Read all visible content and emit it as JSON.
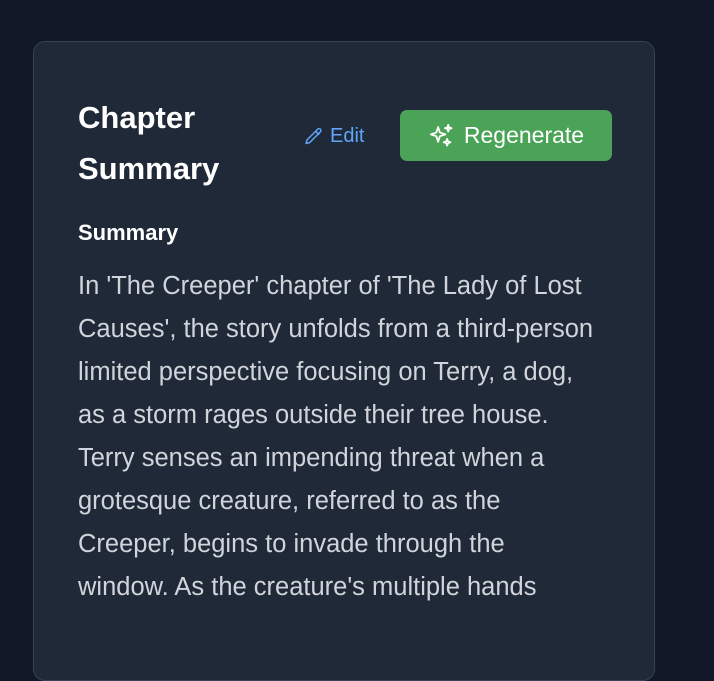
{
  "card": {
    "title": "Chapter Summary",
    "edit_label": "Edit",
    "regenerate_label": "Regenerate",
    "section_label": "Summary",
    "summary_text": "In 'The Creeper' chapter of 'The Lady of Lost Causes', the story unfolds from a third-person limited perspective focusing on Terry, a dog, as a storm rages outside their tree house. Terry senses an impending threat when a grotesque creature, referred to as the Creeper, begins to invade through the window. As the creature's multiple hands"
  },
  "icons": {
    "edit": "pencil-icon",
    "regenerate": "sparkles-icon"
  },
  "colors": {
    "background": "#111827",
    "card": "#1f2937",
    "accent_green": "#4aa356",
    "link_blue": "#60a5fa"
  }
}
